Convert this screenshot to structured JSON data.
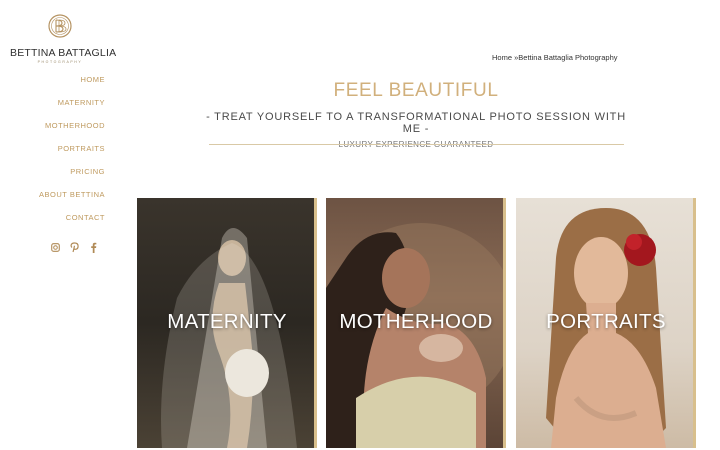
{
  "brand": {
    "name": "BETTINA BATTAGLIA",
    "subtitle": "PHOTOGRAPHY"
  },
  "nav": {
    "items": [
      {
        "label": "HOME"
      },
      {
        "label": "MATERNITY"
      },
      {
        "label": "MOTHERHOOD"
      },
      {
        "label": "PORTRAITS"
      },
      {
        "label": "PRICING"
      },
      {
        "label": "ABOUT BETTINA"
      },
      {
        "label": "CONTACT"
      }
    ]
  },
  "social": [
    {
      "icon": "instagram-icon"
    },
    {
      "icon": "pinterest-icon"
    },
    {
      "icon": "facebook-icon"
    }
  ],
  "breadcrumb": {
    "home": "Home",
    "separator": " »",
    "current": "Bettina Battaglia Photography"
  },
  "hero": {
    "title": "FEEL BEAUTIFUL",
    "subtitle": "- TREAT YOURSELF TO A TRANSFORMATIONAL PHOTO SESSION WITH ME -",
    "tagline": "LUXURY EXPERIENCE GUARANTEED"
  },
  "cards": [
    {
      "label": "MATERNITY"
    },
    {
      "label": "MOTHERHOOD"
    },
    {
      "label": "PORTRAITS"
    }
  ],
  "colors": {
    "accent": "#bf9a5f",
    "title": "#d1b07c",
    "rule": "#d9c9a6"
  }
}
